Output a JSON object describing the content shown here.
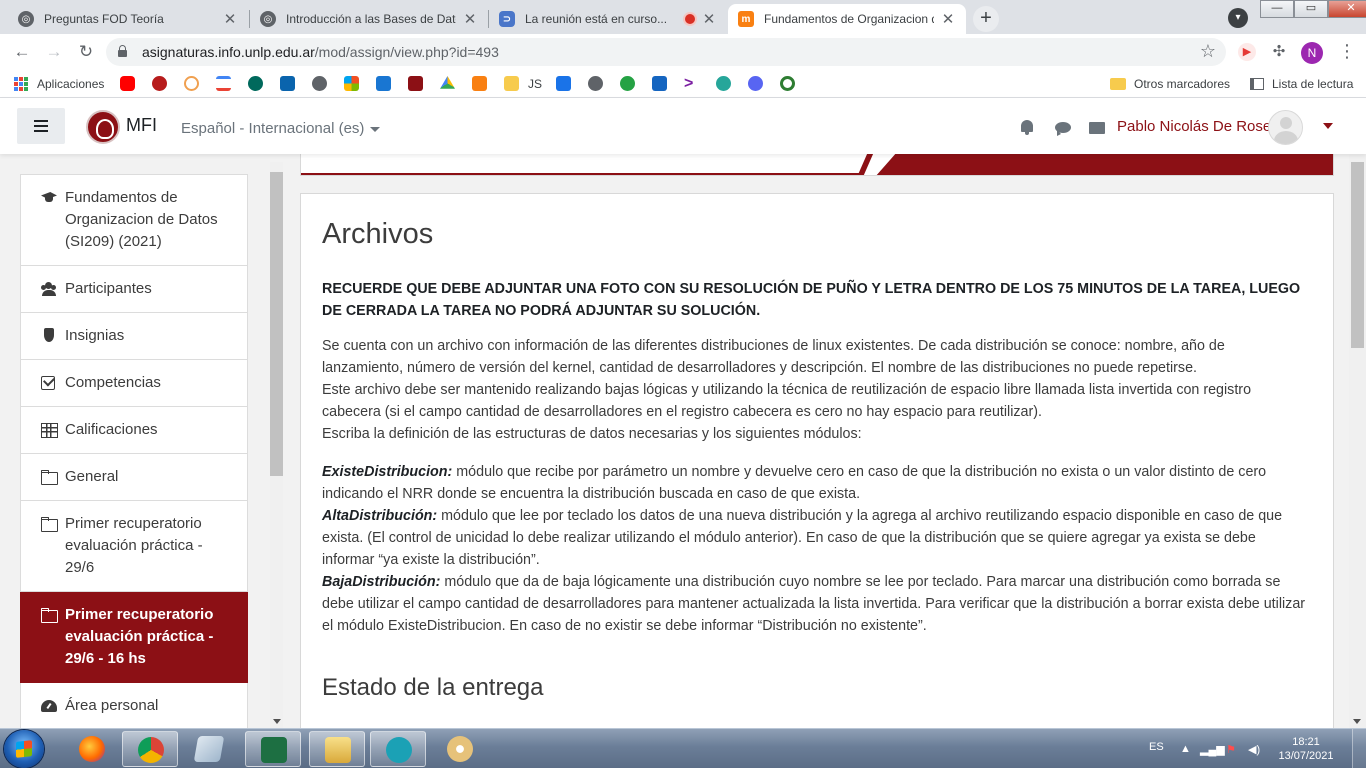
{
  "browser": {
    "tabs": [
      {
        "title": "Preguntas FOD Teoría",
        "active": false
      },
      {
        "title": "Introducción a las Bases de Datos",
        "active": false
      },
      {
        "title": "La reunión está en curso...",
        "active": false,
        "recording": true
      },
      {
        "title": "Fundamentos de Organizacion de",
        "active": true
      }
    ],
    "window_controls": {
      "minimize": "—",
      "maximize": "▭",
      "close": "✕"
    },
    "address": {
      "host": "asignaturas.info.unlp.edu.ar",
      "path": "/mod/assign/view.php?id=493"
    },
    "profile_initial": "N",
    "bookmarks": {
      "apps": "Aplicaciones",
      "js": "JS",
      "other": "Otros marcadores",
      "reading_list": "Lista de lectura"
    },
    "colors": {
      "tabstrip": "#dee1e6",
      "omnibox": "#f1f3f4"
    }
  },
  "navbar": {
    "site_name": "MFI",
    "language": "Español - Internacional (es)",
    "user_name": "Pablo Nicolás De Rose"
  },
  "sidebar": {
    "items": [
      {
        "label": "Fundamentos de Organizacion de Datos (SI209) (2021)",
        "icon": "graduation-cap-icon",
        "active": false
      },
      {
        "label": "Participantes",
        "icon": "users-icon",
        "active": false
      },
      {
        "label": "Insignias",
        "icon": "shield-icon",
        "active": false
      },
      {
        "label": "Competencias",
        "icon": "check-square-icon",
        "active": false
      },
      {
        "label": "Calificaciones",
        "icon": "table-icon",
        "active": false
      },
      {
        "label": "General",
        "icon": "folder-icon",
        "active": false
      },
      {
        "label": "Primer recuperatorio evaluación práctica - 29/6",
        "icon": "folder-icon",
        "active": false
      },
      {
        "label": "Primer recuperatorio evaluación práctica - 29/6 - 16 hs",
        "icon": "folder-icon",
        "active": true
      },
      {
        "label": "Área personal",
        "icon": "dashboard-icon",
        "active": false
      }
    ]
  },
  "main": {
    "title": "Archivos",
    "notice": "RECUERDE QUE DEBE ADJUNTAR UNA FOTO CON SU RESOLUCIÓN DE PUÑO Y LETRA DENTRO DE LOS 75 MINUTOS DE LA TAREA, LUEGO DE CERRADA LA TAREA NO PODRÁ ADJUNTAR SU SOLUCIÓN.",
    "intro": [
      "Se cuenta con un archivo con información de las diferentes distribuciones de linux existentes. De cada distribución se conoce: nombre, año de lanzamiento, número de versión del kernel, cantidad de desarrolladores y descripción. El nombre de las distribuciones no puede repetirse.",
      "Este archivo debe ser mantenido realizando bajas lógicas y utilizando la técnica de reutilización de espacio libre llamada lista invertida con registro cabecera (si el campo cantidad de desarrolladores en el registro cabecera es cero no hay espacio para reutilizar).",
      "Escriba la definición de las estructuras de datos necesarias y los siguientes módulos:"
    ],
    "modules": [
      {
        "name": "ExisteDistribucion:",
        "text": " módulo que recibe por parámetro un nombre y devuelve cero en caso de que la distribución no exista o un valor distinto de cero indicando el NRR donde se encuentra la distribución buscada en caso de que exista."
      },
      {
        "name": "AltaDistribución:",
        "text": " módulo que lee por teclado los datos de una nueva distribución y la agrega al archivo reutilizando espacio disponible en caso de que exista. (El control de unicidad lo debe realizar utilizando el módulo anterior). En caso de que la distribución que se quiere agregar ya exista se debe informar “ya existe la distribución”."
      },
      {
        "name": "BajaDistribución:",
        "text": " módulo que da de baja lógicamente una distribución  cuyo nombre se lee por teclado. Para marcar una distribución como borrada se debe utilizar el campo cantidad de desarrolladores para mantener actualizada la lista invertida. Para verificar que la distribución a borrar exista debe utilizar el módulo ExisteDistribucion. En caso de no existir se debe informar “Distribución no existente”."
      }
    ],
    "status_title": "Estado de la entrega"
  },
  "taskbar": {
    "language": "ES",
    "time": "18:21",
    "date": "13/07/2021"
  },
  "theme": {
    "brand": "#8c1015",
    "page_bg": "#f2f2f2"
  }
}
